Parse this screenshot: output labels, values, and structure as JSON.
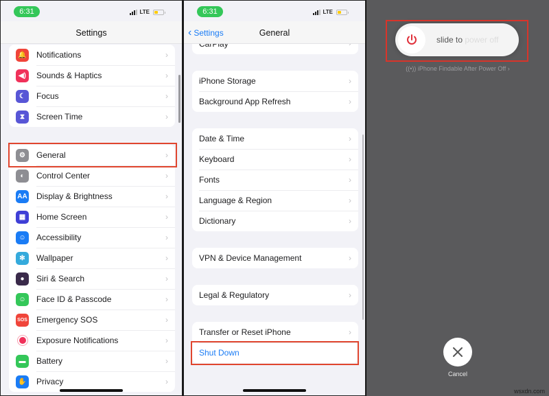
{
  "status_bar": {
    "time": "6:31",
    "network": "LTE"
  },
  "panel1": {
    "title": "Settings",
    "group1": [
      {
        "label": "Notifications",
        "icon": "bell-icon",
        "color": "#f0453a"
      },
      {
        "label": "Sounds & Haptics",
        "icon": "speaker-icon",
        "color": "#f0315a"
      },
      {
        "label": "Focus",
        "icon": "moon-icon",
        "color": "#5856d6"
      },
      {
        "label": "Screen Time",
        "icon": "hourglass-icon",
        "color": "#5856d6"
      }
    ],
    "group2": [
      {
        "label": "General",
        "icon": "gear-icon",
        "color": "#8e8e93"
      },
      {
        "label": "Control Center",
        "icon": "toggles-icon",
        "color": "#8e8e93"
      },
      {
        "label": "Display & Brightness",
        "icon": "text-size-icon",
        "color": "#1a7cf5",
        "glyph": "AA"
      },
      {
        "label": "Home Screen",
        "icon": "home-grid-icon",
        "color": "#3f3fd6"
      },
      {
        "label": "Accessibility",
        "icon": "accessibility-icon",
        "color": "#1a7cf5"
      },
      {
        "label": "Wallpaper",
        "icon": "flower-icon",
        "color": "#35aadc"
      },
      {
        "label": "Siri & Search",
        "icon": "siri-icon",
        "color": "#3a2a4a"
      },
      {
        "label": "Face ID & Passcode",
        "icon": "face-id-icon",
        "color": "#34c759"
      },
      {
        "label": "Emergency SOS",
        "icon": "sos-icon",
        "color": "#f0453a",
        "glyph": "SOS"
      },
      {
        "label": "Exposure Notifications",
        "icon": "exposure-icon",
        "color": "#ffffff"
      },
      {
        "label": "Battery",
        "icon": "battery-icon",
        "color": "#34c759"
      },
      {
        "label": "Privacy",
        "icon": "hand-icon",
        "color": "#1a7cf5"
      }
    ]
  },
  "panel2": {
    "back_label": "Settings",
    "title": "General",
    "partial_row": "CarPlay",
    "group1": [
      "iPhone Storage",
      "Background App Refresh"
    ],
    "group2": [
      "Date & Time",
      "Keyboard",
      "Fonts",
      "Language & Region",
      "Dictionary"
    ],
    "group3": [
      "VPN & Device Management"
    ],
    "group4": [
      "Legal & Regulatory"
    ],
    "group5": [
      "Transfer or Reset iPhone"
    ],
    "shutdown_label": "Shut Down",
    "accent": "#1a7cf5"
  },
  "panel3": {
    "slider_text_visible": "slide to ",
    "slider_text_faded": "power off",
    "findable_text": "iPhone Findable After Power Off",
    "cancel_label": "Cancel",
    "power_color": "#e0303a"
  },
  "highlight_color": "#e0452e",
  "watermark": "wsxdn.com"
}
